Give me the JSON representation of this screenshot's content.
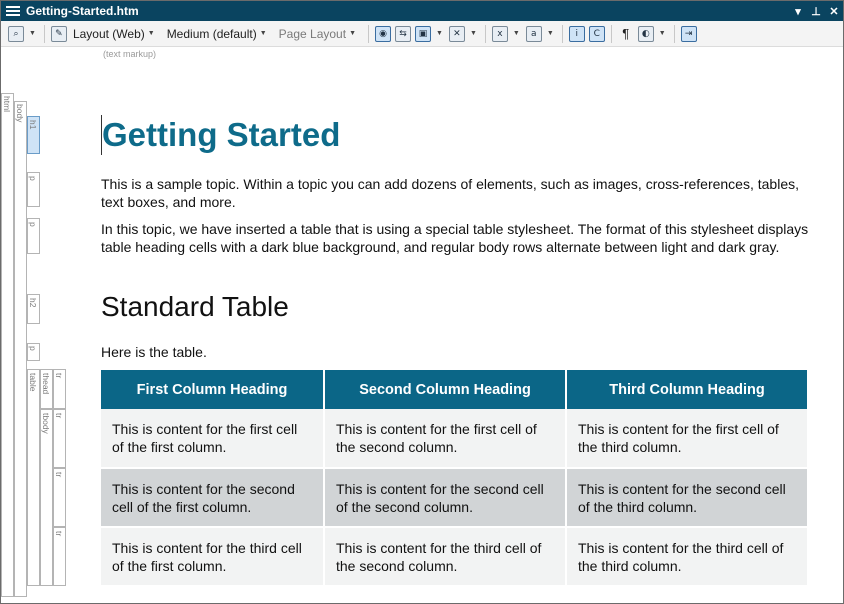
{
  "window": {
    "title": "Getting-Started.htm"
  },
  "title_controls": {
    "dropdown": "▾",
    "pin": "⊥",
    "close": "✕"
  },
  "toolbar": {
    "layout_label": "Layout (Web)",
    "medium_label": "Medium (default)",
    "page_layout_label": "Page Layout",
    "pilcrow": "¶"
  },
  "markup_label": "(text markup)",
  "structure": {
    "html": "html",
    "body": "body",
    "h1": "h1",
    "p1": "p",
    "p2": "p",
    "h2": "h2",
    "p3": "p",
    "table": "table",
    "thead": "thead",
    "tbody": "tbody",
    "tr_head": "tr",
    "tr1": "tr",
    "tr2": "tr",
    "tr3": "tr"
  },
  "document": {
    "heading1": "Getting Started",
    "para1": "This is a sample topic. Within a topic you can add dozens of elements, such as images, cross-references, tables, text boxes, and more.",
    "para2": "In this topic, we have inserted a table that is using a special table stylesheet. The format of this stylesheet displays table heading cells with a dark blue background, and regular body rows alternate between light and dark gray.",
    "heading2": "Standard Table",
    "para3": "Here is the table."
  },
  "table": {
    "headers": [
      "First Column Heading",
      "Second Column Heading",
      "Third Column Heading"
    ],
    "rows": [
      [
        "This is content for the first cell of the first column.",
        "This is content for the first cell of the second column.",
        "This is content for the first cell of the third column."
      ],
      [
        "This is content for the second cell of the first column.",
        "This is content for the second cell of the second column.",
        "This is content for the second cell of the third column."
      ],
      [
        "This is content for the third cell of the first column.",
        "This is content for the third cell of the second column.",
        "This is content for the third cell of the third column."
      ]
    ]
  },
  "colors": {
    "titlebar": "#0a4460",
    "heading1": "#0e6b8a",
    "table_header": "#0b6687",
    "row_light": "#f2f3f3",
    "row_dark": "#d1d4d6"
  }
}
